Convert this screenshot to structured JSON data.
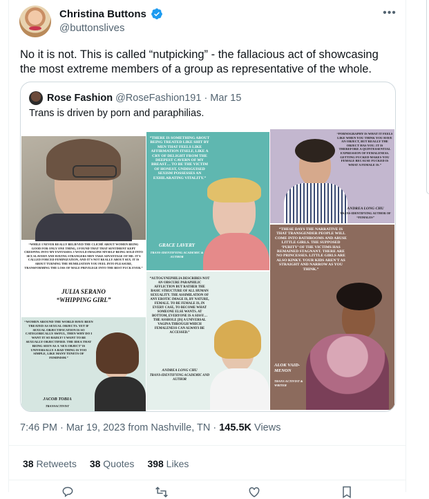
{
  "author": {
    "name": "Christina Buttons",
    "handle": "@buttonslives"
  },
  "tweet": {
    "text": "No it is not. This is called “nutpicking” - the fallacious act of showcasing the most extreme members of a group as representative of the whole."
  },
  "quoted": {
    "name": "Rose Fashion",
    "handle": "@RoseFashion191",
    "date": "· Mar 15",
    "text": "Trans is driven by porn and paraphilias.",
    "panels": {
      "julia_quote": "“While I never really believed the cliché about women being good for only one thing, I found that that sentiment kept creeping into my fantasies. I would imagine myself being sold into sex slavery and having strangers men take advantage of me. It's called forced feminization, and it's not really about sex. It is about turning the humiliation you feel into pleasure, transforming the loss of male privilege into the best fuck ever.”",
      "julia_name": "Julia Serano",
      "julia_book": "“Whipping Girl”",
      "grace_quote": "“There is something about being treated like shit by men that feels like affirmation itself, like a cry of delight from the deepest cavern of my breast… To be the victim of honest, undisguised sexism possesses an exhilarating vitality.”",
      "grace_name": "Grace Lavery",
      "grace_role": "Trans-identifying academic & author",
      "andrea1_quote": "“Pornography is what it feels like when you think you have an object, but really the object has you. It is therefore a quintessential expression of femaleness. Getting fucked makes you female because fucked is what a female is.”",
      "andrea1_name": "Andrea Long Chu",
      "andrea1_role": "Trans-identifying author of “Females”",
      "jacob_quote": "“Women around the world have been treated as sexual objects. Yet if sexual objectification is so categorically awful, then why do I want it so badly? I want to be sexually objectified. The idea that being seen as a ‘sex object’ is universally a bad thing is too simple, like many tenets of feminism.”",
      "jacob_name": "Jacob Tobia",
      "jacob_role": "Transactivist",
      "andrea2_quote": "“Autogynephilia describes not an obscure paraphilic affliction but rather the basic structure of all human sexuality. The assimilation of any erotic image is, by nature, female. To be female is, in every case, to become what someone else wants. At bottom, everyone is a sissy… The asshole [is] a universal vagina through which femaleness can always be accessed.”",
      "andrea2_name": "Andrea Long Chu",
      "andrea2_role": "Trans-identifying academic and author",
      "alok_quote": "“These days the narrative is that transgender people will come into bathrooms and abuse little girls. The supposed ‘purity’ of the victims has remained stagnant. There are no princesses. Little girls are also kinky. Your kids aren't as straight and narrow as you think.”",
      "alok_name": "Alok Vaid-Menon",
      "alok_role": "Trans activist & writer"
    }
  },
  "meta": {
    "time": "7:46 PM · Mar 19, 2023 from Nashville, TN · ",
    "views_count": "145.5K",
    "views_label": " Views"
  },
  "stats": {
    "retweets_count": "38",
    "retweets_label": " Retweets",
    "quotes_count": "38",
    "quotes_label": " Quotes",
    "likes_count": "398",
    "likes_label": " Likes"
  },
  "colors": {
    "verified": "#1d9bf0",
    "text_primary": "#0f1419",
    "text_secondary": "#536471",
    "border": "#cfd9de"
  },
  "icons": [
    "verified-badge-icon",
    "more-icon",
    "reply-icon",
    "retweet-icon",
    "like-icon",
    "bookmark-icon"
  ]
}
